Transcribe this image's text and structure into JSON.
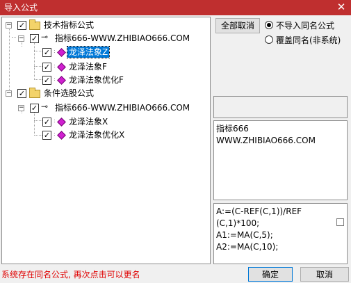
{
  "window": {
    "title": "导入公式",
    "close_glyph": "✕"
  },
  "tree": {
    "nodes": [
      {
        "id": "n1",
        "label": "技术指标公式",
        "checked": true,
        "expanded": true,
        "icon": "folder-icon"
      },
      {
        "id": "n2",
        "label": "指标666-WWW.ZHIBIAO666.COM",
        "checked": true,
        "expanded": true,
        "icon": "key-icon"
      },
      {
        "id": "n3",
        "label": "龙泽法象Z",
        "checked": true,
        "selected": true,
        "icon": "formula-icon"
      },
      {
        "id": "n4",
        "label": "龙泽法象F",
        "checked": true,
        "icon": "formula-icon"
      },
      {
        "id": "n5",
        "label": "龙泽法象优化F",
        "checked": true,
        "icon": "formula-icon"
      },
      {
        "id": "n6",
        "label": "条件选股公式",
        "checked": true,
        "expanded": true,
        "icon": "folder-icon"
      },
      {
        "id": "n7",
        "label": "指标666-WWW.ZHIBIAO666.COM",
        "checked": true,
        "expanded": true,
        "icon": "key-icon"
      },
      {
        "id": "n8",
        "label": "龙泽法象X",
        "checked": true,
        "icon": "formula-icon"
      },
      {
        "id": "n9",
        "label": "龙泽法象优化X",
        "checked": true,
        "icon": "formula-icon"
      }
    ],
    "check_glyph": "✓",
    "toggle_glyph": "−"
  },
  "options": {
    "cancel_all_label": "全部取消",
    "radio1_label": "不导入同名公式",
    "radio2_label": "覆盖同名(非系统)",
    "selected_radio": 1
  },
  "info": {
    "line1": "指标666",
    "line2": "WWW.ZHIBIAO666.COM"
  },
  "code": {
    "text": "A:=(C-REF(C,1))/REF\n(C,1)*100;\nA1:=MA(C,5);\nA2:=MA(C,10);"
  },
  "status": {
    "text": "系统存在同名公式, 再次点击可以更名"
  },
  "buttons": {
    "ok": "确定",
    "cancel": "取消"
  }
}
